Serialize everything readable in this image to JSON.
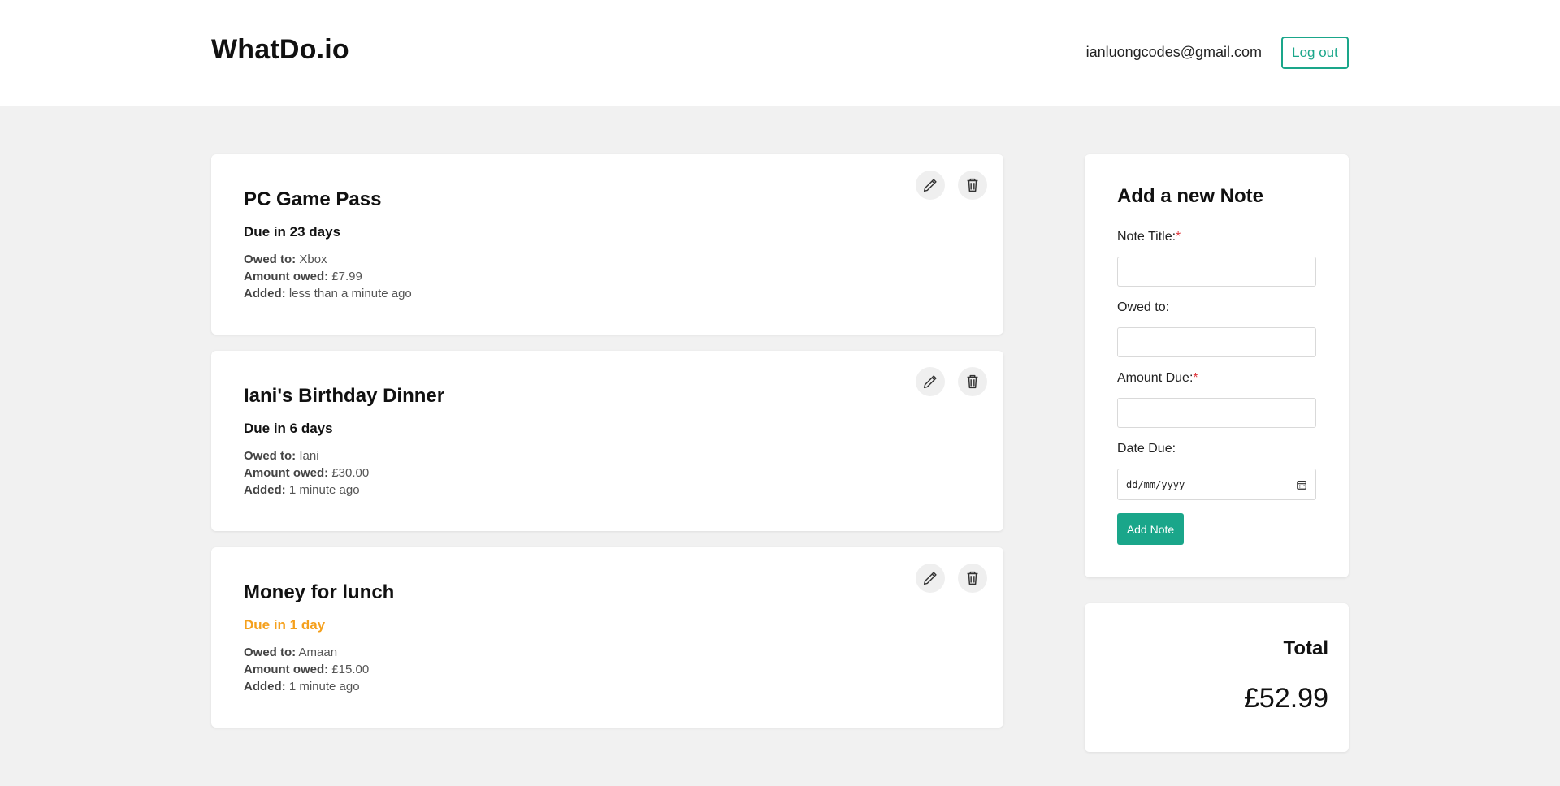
{
  "header": {
    "brand": "WhatDo.io",
    "user_email": "ianluongcodes@gmail.com",
    "logout_label": "Log out"
  },
  "notes": [
    {
      "title": "PC Game Pass",
      "due": "Due in 23 days",
      "owed_to_label": "Owed to:",
      "owed_to": "Xbox",
      "amount_label": "Amount owed:",
      "amount": "£7.99",
      "added_label": "Added:",
      "added": "less than a minute ago"
    },
    {
      "title": "Iani's Birthday Dinner",
      "due": "Due in 6 days",
      "owed_to_label": "Owed to:",
      "owed_to": "Iani",
      "amount_label": "Amount owed:",
      "amount": "£30.00",
      "added_label": "Added:",
      "added": "1 minute ago"
    },
    {
      "title": "Money for lunch",
      "due": "Due in 1 day",
      "owed_to_label": "Owed to:",
      "owed_to": "Amaan",
      "amount_label": "Amount owed:",
      "amount": "£15.00",
      "added_label": "Added:",
      "added": "1 minute ago"
    }
  ],
  "note_icons": {
    "edit": "pencil-icon",
    "delete": "trash-icon"
  },
  "form": {
    "heading": "Add a new Note",
    "title_label": "Note Title:",
    "owed_to_label": "Owed to:",
    "amount_label": "Amount Due:",
    "date_label": "Date Due:",
    "required_marker": "*",
    "title_value": "",
    "owed_to_value": "",
    "amount_value": "",
    "date_placeholder": "dd/mm/yyyy",
    "submit_label": "Add Note"
  },
  "total": {
    "label": "Total",
    "value": "£52.99"
  },
  "colors": {
    "accent": "#1aa68a",
    "warning": "#f5a01c",
    "required": "#e0393e",
    "background": "#f1f1f1"
  }
}
